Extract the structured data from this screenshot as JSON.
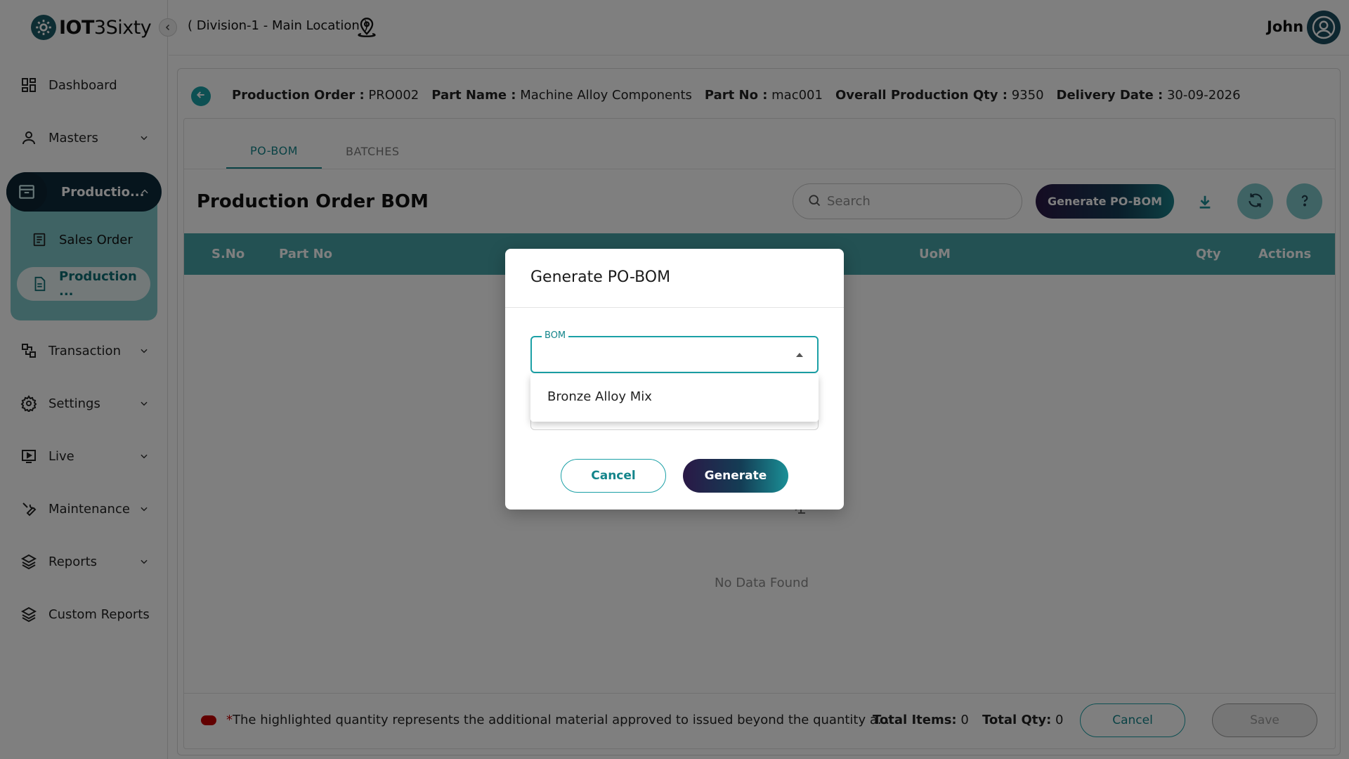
{
  "brand": {
    "logo_bold": "IOT",
    "logo_light": "3Sixty"
  },
  "sidebar": {
    "items": [
      {
        "label": "Dashboard",
        "icon": "dashboard-icon"
      },
      {
        "label": "Masters",
        "icon": "user-icon"
      },
      {
        "label": "Productio...",
        "icon": "archive-icon"
      },
      {
        "label": "Transaction",
        "icon": "transaction-icon"
      },
      {
        "label": "Settings",
        "icon": "gear-icon"
      },
      {
        "label": "Live",
        "icon": "play-icon"
      },
      {
        "label": "Maintenance",
        "icon": "wrench-icon"
      },
      {
        "label": "Reports",
        "icon": "layers-icon"
      },
      {
        "label": "Custom Reports",
        "icon": "layers-icon"
      }
    ],
    "production_sub": [
      {
        "label": "Sales Order",
        "icon": "sales-order-icon"
      },
      {
        "label": "Production ...",
        "icon": "document-icon"
      }
    ]
  },
  "topbar": {
    "location": "( Division-1 - Main Location )",
    "username": "John"
  },
  "order_info": {
    "production_order_label": "Production Order :",
    "production_order_value": "PRO002",
    "part_name_label": "Part Name :",
    "part_name_value": "Machine Alloy Components",
    "part_no_label": "Part No :",
    "part_no_value": "mac001",
    "overall_qty_label": "Overall Production Qty :",
    "overall_qty_value": "9350",
    "delivery_date_label": "Delivery Date :",
    "delivery_date_value": "30-09-2026"
  },
  "tabs": [
    {
      "label": "PO-BOM",
      "active": true
    },
    {
      "label": "BATCHES",
      "active": false
    }
  ],
  "section": {
    "title": "Production Order BOM",
    "search_placeholder": "Search",
    "generate_button": "Generate PO-BOM"
  },
  "table": {
    "columns": [
      "S.No",
      "Part No",
      "UoM",
      "Qty",
      "Actions"
    ],
    "rows": [],
    "empty_text": "No Data Found"
  },
  "footer": {
    "note": "The highlighted quantity represents the additional material approved to issued beyond the quantity a...",
    "note_asterisk": "*",
    "total_items_label": "Total Items:",
    "total_items_value": "0",
    "total_qty_label": "Total Qty:",
    "total_qty_value": "0",
    "cancel_label": "Cancel",
    "save_label": "Save"
  },
  "modal": {
    "title": "Generate PO-BOM",
    "bom_label": "BOM",
    "bom_value": "",
    "options": [
      "Bronze Alloy Mix"
    ],
    "cancel_label": "Cancel",
    "generate_label": "Generate"
  },
  "colors": {
    "accent": "#1ba0a6",
    "sidebar_active": "#0d2a3a",
    "table_header": "#47a3a6",
    "note_marker": "#c40000"
  }
}
